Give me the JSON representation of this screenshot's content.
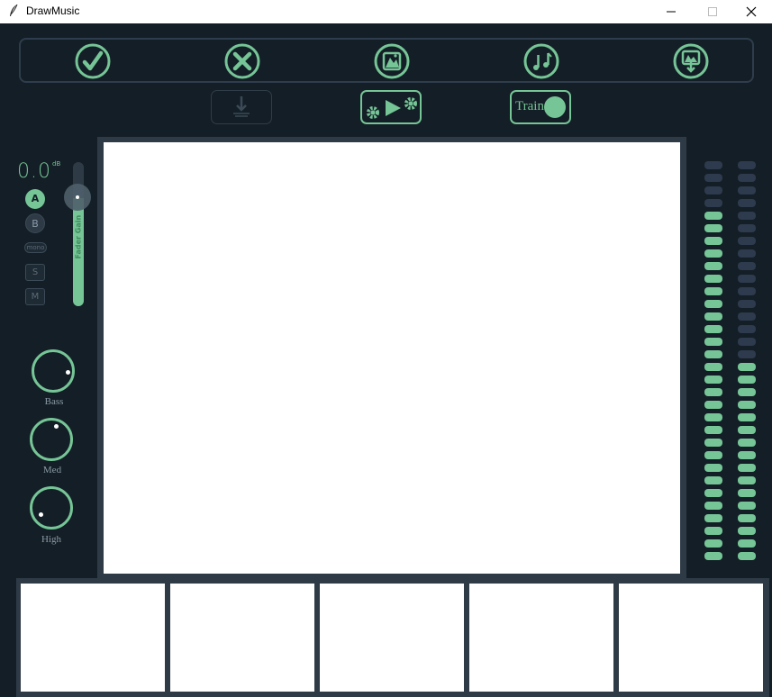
{
  "window": {
    "title": "DrawMusic"
  },
  "toolbar": {
    "buttons": [
      {
        "name": "confirm-button",
        "icon": "check-icon"
      },
      {
        "name": "cancel-button",
        "icon": "close-icon"
      },
      {
        "name": "image-button",
        "icon": "image-icon"
      },
      {
        "name": "music-button",
        "icon": "music-note-icon"
      },
      {
        "name": "export-button",
        "icon": "image-download-icon"
      }
    ]
  },
  "secondary_toolbar": {
    "download_icon": "download-icon",
    "play_settings_icon": "play-settings-icon",
    "train_label": "Train"
  },
  "channel": {
    "gain_value": "0.0",
    "gain_unit": "dB",
    "button_a": "A",
    "button_b": "B",
    "mono": "mono",
    "solo": "S",
    "mute": "M",
    "fader_label": "Fader Gain",
    "fader_level": 0.75
  },
  "eq": {
    "bass_label": "Bass",
    "med_label": "Med",
    "high_label": "High"
  },
  "meters": {
    "left_lit": 28,
    "right_lit": 16,
    "total": 32
  },
  "colors": {
    "accent": "#75c596",
    "background": "#141e26",
    "inactive_segment": "#2e3a4d",
    "frame": "#2e3b47"
  },
  "thumbnails": [
    "",
    "",
    "",
    "",
    ""
  ]
}
